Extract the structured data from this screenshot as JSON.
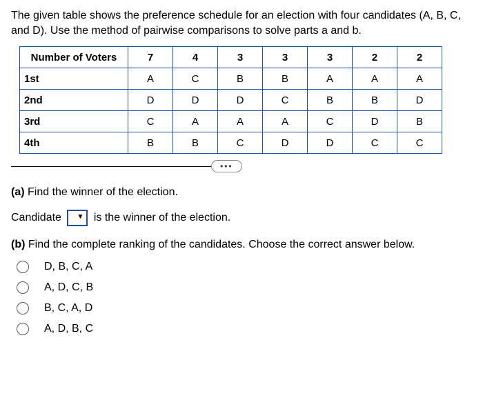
{
  "intro": "The given table shows the preference schedule for an election with four candidates (A, B, C, and D). Use the method of pairwise comparisons to solve parts a and b.",
  "table": {
    "header_label": "Number of Voters",
    "voter_counts": [
      "7",
      "4",
      "3",
      "3",
      "3",
      "2",
      "2"
    ],
    "rows": [
      {
        "label": "1st",
        "cells": [
          "A",
          "C",
          "B",
          "B",
          "A",
          "A",
          "A"
        ]
      },
      {
        "label": "2nd",
        "cells": [
          "D",
          "D",
          "D",
          "C",
          "B",
          "B",
          "D"
        ]
      },
      {
        "label": "3rd",
        "cells": [
          "C",
          "A",
          "A",
          "A",
          "C",
          "D",
          "B"
        ]
      },
      {
        "label": "4th",
        "cells": [
          "B",
          "B",
          "C",
          "D",
          "D",
          "C",
          "C"
        ]
      }
    ]
  },
  "ellipsis": "•••",
  "part_a": {
    "label": "(a)",
    "text": "Find the winner of the election.",
    "answer_prefix": "Candidate",
    "answer_suffix": "is the winner of the election."
  },
  "part_b": {
    "label": "(b)",
    "text": "Find the complete ranking of the candidates. Choose the correct answer below.",
    "options": [
      "D, B, C, A",
      "A, D, C, B",
      "B, C, A, D",
      "A, D, B, C"
    ]
  }
}
